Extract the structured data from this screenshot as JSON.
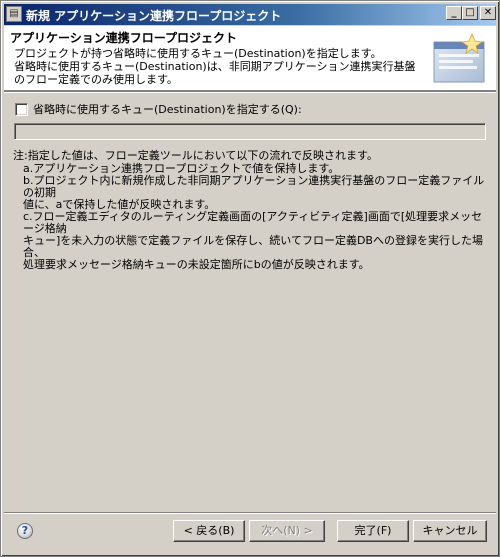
{
  "window": {
    "title": "新規 アプリケーション連携フロープロジェクト",
    "icon": "window-app-icon",
    "controls": {
      "minimize": "_",
      "maximize": "□",
      "close": "✕"
    }
  },
  "header": {
    "title": "アプリケーション連携フロープロジェクト",
    "description": "プロジェクトが持つ省略時に使用するキュー(Destination)を指定します。\n省略時に使用するキュー(Destination)は、非同期アプリケーション連携実行基盤のフロー定義でのみ使用します。"
  },
  "form": {
    "checkbox_label": "省略時に使用するキュー(Destination)を指定する(Q):",
    "checkbox_checked": false,
    "destination_value": ""
  },
  "note": {
    "main": "注:指定した値は、フロー定義ツールにおいて以下の流れで反映されます。",
    "items": [
      "a.アプリケーション連携フロープロジェクトで値を保持します。",
      "b.プロジェクト内に新規作成した非同期アプリケーション連携実行基盤のフロー定義ファイルの初期\n値に、aで保持した値が反映されます。",
      "c.フロー定義エディタのルーティング定義画面の[アクティビティ定義]画面で[処理要求メッセージ格納\nキュー]を未入力の状態で定義ファイルを保存し、続いてフロー定義DBへの登録を実行した場合、\n処理要求メッセージ格納キューの未設定箇所にbの値が反映されます。"
    ]
  },
  "buttons": {
    "help": "?",
    "back": "< 戻る(B)",
    "next": "次へ(N) >",
    "finish": "完了(F)",
    "cancel": "キャンセル"
  }
}
